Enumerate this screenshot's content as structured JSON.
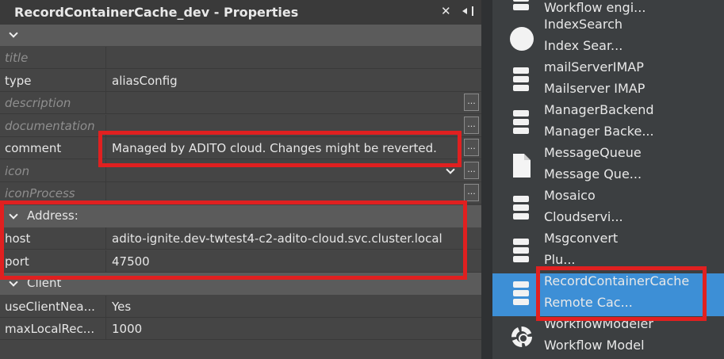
{
  "panel": {
    "title": "RecordContainerCache_dev - Properties",
    "close_glyph": "✕",
    "dock_icon": "dock-icon"
  },
  "properties": [
    {
      "name": "title",
      "value": "",
      "dim": true
    },
    {
      "name": "type",
      "value": "aliasConfig",
      "dim": false
    },
    {
      "name": "description",
      "value": "",
      "dim": true,
      "ellipsis": "..."
    },
    {
      "name": "documentation",
      "value": "",
      "dim": true,
      "ellipsis": "..."
    },
    {
      "name": "comment",
      "value": "Managed by ADITO cloud. Changes might be reverted.",
      "dim": false,
      "ellipsis": "..."
    },
    {
      "name": "icon",
      "value": "",
      "dim": true,
      "ellipsis": "..."
    },
    {
      "name": "iconProcess",
      "value": "",
      "dim": true,
      "ellipsis": "..."
    }
  ],
  "address_group": {
    "label": "Address:",
    "rows": [
      {
        "name": "host",
        "value": "adito-ignite.dev-twtest4-c2-adito-cloud.svc.cluster.local"
      },
      {
        "name": "port",
        "value": "47500"
      }
    ]
  },
  "client_group": {
    "label": "Client",
    "rows": [
      {
        "name": "useClientNea...",
        "value": "Yes"
      },
      {
        "name": "maxLocalRec...",
        "value": "1000"
      }
    ]
  },
  "services": [
    {
      "line1": "Workflow engi...",
      "line2": "",
      "icon": "server-icon"
    },
    {
      "line1": "IndexSearch",
      "line2": "Index Sear...",
      "icon": "globe-icon"
    },
    {
      "line1": "mailServerIMAP",
      "line2": "Mailserver IMAP",
      "icon": "server-icon"
    },
    {
      "line1": "ManagerBackend",
      "line2": "Manager Backe...",
      "icon": "server-icon"
    },
    {
      "line1": "MessageQueue",
      "line2": "Message Que...",
      "icon": "document-icon"
    },
    {
      "line1": "Mosaico",
      "line2": "Cloudservi...",
      "icon": "server-icon"
    },
    {
      "line1": "Msgconvert",
      "line2": "Plu...",
      "icon": "server-icon"
    },
    {
      "line1": "RecordContainerCache",
      "line2": "Remote Cac...",
      "icon": "server-icon",
      "selected": true
    },
    {
      "line1": "WorkflowModeler",
      "line2": "Workflow Model",
      "icon": "gear-icon"
    }
  ],
  "colors": {
    "highlight": "#e02020",
    "selection": "#3d8fd6"
  }
}
